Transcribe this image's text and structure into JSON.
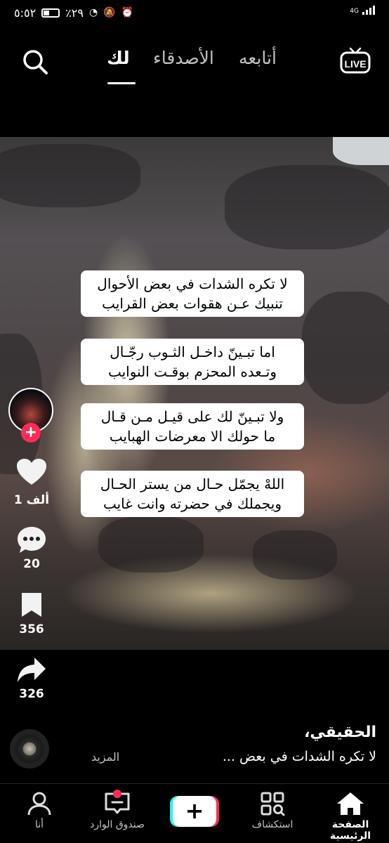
{
  "status_bar": {
    "time": "٥:٥٢",
    "battery": "٪٢٩",
    "network": "4G"
  },
  "top_nav": {
    "tabs": [
      "لك",
      "الأصدقاء",
      "أتابعه"
    ],
    "active_tab": "لك",
    "live_label": "LIVE"
  },
  "video": {
    "verses": [
      [
        "لا تكره الشدات في بعض الأحوال",
        "تنبيك عـن هقوات بعض القرايب"
      ],
      [
        "اما تبـينّ داخـل الثـوب رجّـال",
        "وتـعده المحزم بوقـت النوايب"
      ],
      [
        "ولا تبـينّ لك على قيـل مـن قـال",
        "ما حولك الا معرضات الهبايب"
      ],
      [
        "اللهْ يجمّل حـال من يستر الحـال",
        "ويجملك في حضرته وانت غايب"
      ]
    ]
  },
  "actions": {
    "likes": "1 ألف",
    "comments": "20",
    "saves": "356",
    "shares": "326"
  },
  "caption": {
    "author": "الحقيقي،",
    "description": "لا تكره الشدات في بعض ...",
    "more": "المزيد"
  },
  "bottom_nav": {
    "home": "الصفحة الرئيسية",
    "discover": "استكشاف",
    "inbox": "صندوق الوارد",
    "me": "أنا"
  }
}
